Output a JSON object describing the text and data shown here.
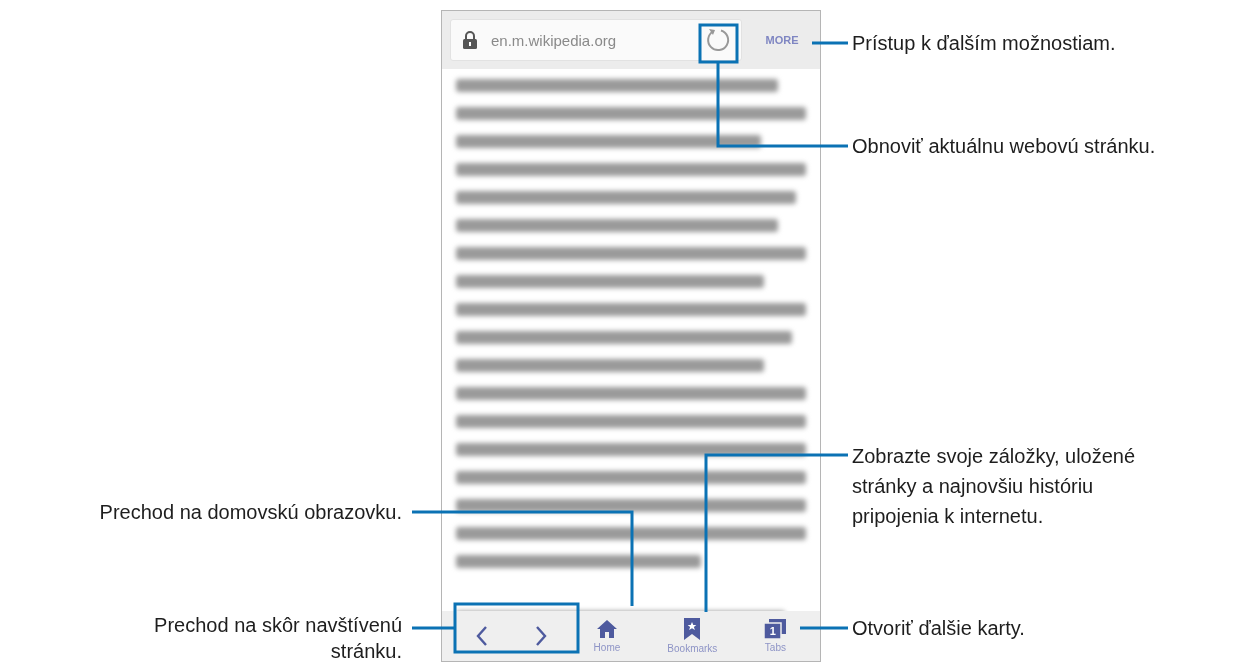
{
  "browser": {
    "url": "en.m.wikipedia.org",
    "more": "MORE",
    "nav": [
      {
        "kind": "back"
      },
      {
        "kind": "forward"
      },
      {
        "kind": "home",
        "label": "Home"
      },
      {
        "kind": "bookmarks",
        "label": "Bookmarks"
      },
      {
        "kind": "tabs",
        "label": "Tabs",
        "badge": "1"
      }
    ]
  },
  "right_callouts": [
    {
      "text": "Prístup k ďalším možnostiam."
    },
    {
      "text": "Obnoviť aktuálnu webovú stránku."
    },
    {
      "text": "Zobrazte svoje záložky, uložené stránky a najnovšiu históriu pripojenia k internetu."
    },
    {
      "text": "Otvoriť ďalšie karty."
    }
  ],
  "left_callouts": [
    {
      "text": "Prechod na domovskú obrazovku."
    },
    {
      "text": "Prechod na skôr navštívenú stránku."
    }
  ]
}
